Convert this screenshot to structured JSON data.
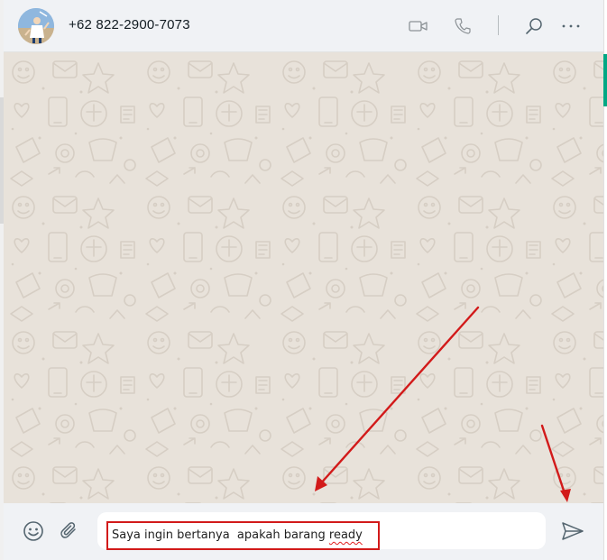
{
  "header": {
    "contact_name": "+62 822-2900-7073",
    "icons": {
      "video": "video-call-icon",
      "voice": "voice-call-icon",
      "search": "search-icon",
      "menu": "more-options-icon"
    }
  },
  "composer": {
    "text_before": "Saya ingin bertanya  apakah barang ",
    "text_misspelled": "ready",
    "icons": {
      "emoji": "emoji-icon",
      "attach": "paperclip-icon",
      "send": "send-icon"
    }
  },
  "colors": {
    "header_bg": "#f0f2f5",
    "chat_bg": "#e8e2da",
    "annotation_red": "#d21a1a",
    "accent": "#00a884"
  }
}
